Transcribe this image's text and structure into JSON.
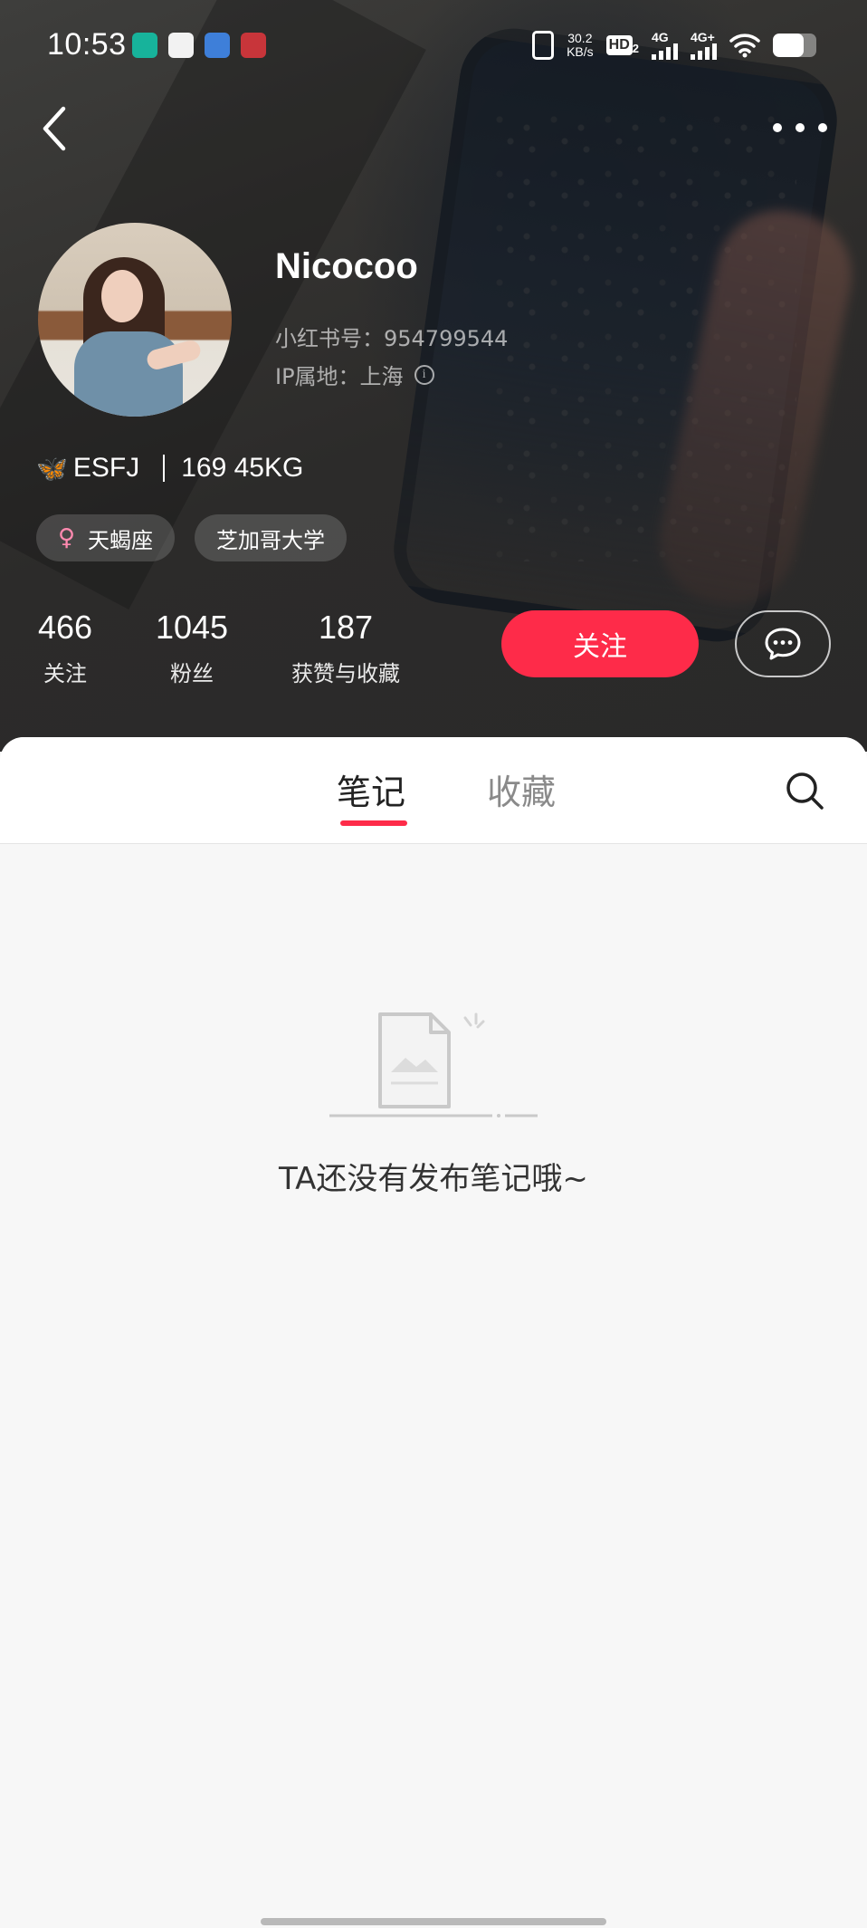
{
  "status_bar": {
    "time": "10:53",
    "net_speed_value": "30.2",
    "net_speed_unit": "KB/s",
    "hd_label": "HD",
    "hd_sub": "2",
    "sim1": "4G",
    "sim2": "4G+",
    "battery_level": 0.7
  },
  "profile": {
    "username": "Nicocoo",
    "red_id": "小红书号：954799544",
    "ip_location": "IP属地：上海",
    "bio_mbti": "ESFJ",
    "bio_body": "169 45KG",
    "tags": [
      {
        "label": "天蝎座",
        "icon": "female-icon"
      },
      {
        "label": "芝加哥大学"
      }
    ]
  },
  "stats": [
    {
      "value": "466",
      "label": "关注"
    },
    {
      "value": "1045",
      "label": "粉丝"
    },
    {
      "value": "187",
      "label": "获赞与收藏"
    }
  ],
  "actions": {
    "follow_label": "关注"
  },
  "tabs": [
    {
      "label": "笔记",
      "active": true
    },
    {
      "label": "收藏",
      "active": false
    }
  ],
  "empty_state": {
    "message": "TA还没有发布笔记哦~"
  },
  "colors": {
    "accent": "#fe2b49",
    "header_bg": "#2e2d2c",
    "content_bg": "#f7f7f7"
  }
}
